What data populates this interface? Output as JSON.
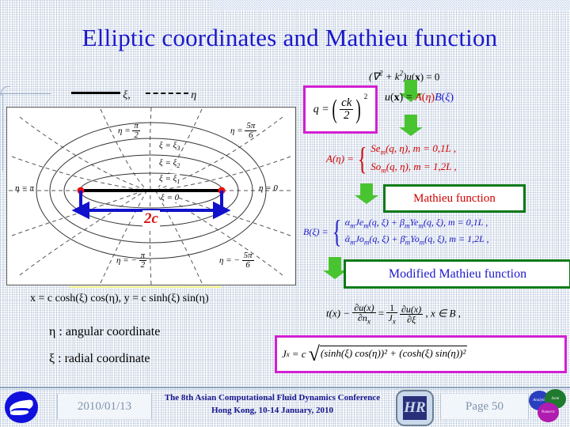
{
  "slide": {
    "title": "Elliptic coordinates and Mathieu function"
  },
  "legend": {
    "xi_label": "ξ,",
    "eta_label": "η"
  },
  "diagram": {
    "name": "elliptic-coordinate-system",
    "segment_label": "2c",
    "labels": {
      "eta_pi_half": "η =",
      "eta_5pi_6": "η =",
      "eta_pi": "η = π",
      "eta_0": "η = 0",
      "eta_neg_pi_half": "η = −",
      "eta_neg_5pi_6": "η = −",
      "xi_3": "ξ = ξ",
      "xi_3_sub": "3",
      "xi_2": "ξ = ξ",
      "xi_2_sub": "2",
      "xi_1": "ξ = ξ",
      "xi_1_sub": "1",
      "xi_0": "ξ = 0",
      "pi_num": "π",
      "two_den": "2",
      "five_pi_num": "5π",
      "six_den": "6"
    }
  },
  "equations": {
    "helmholtz": "(∇² + k²)u(x) = 0",
    "q_definition_lhs": "q =",
    "q_numerator": "ck",
    "q_denominator": "2",
    "q_power": "2",
    "separation": "u(x) = A(η)B(ξ)",
    "A_lhs": "A(η) =",
    "A_case1": "Se",
    "A_case1_sub": "m",
    "A_case1_rest": "(q, η), m = 0,1L  ,",
    "A_case2": "So",
    "A_case2_sub": "m",
    "A_case2_rest": "(q, η), m = 1,2L  ,",
    "B_lhs": "B(ξ) =",
    "B_case1": "α",
    "B_case1_sub": "m",
    "B_case1_mid": "Je",
    "B_case1_mid_sub": "m",
    "B_case1_rest": "(q, ξ) + β",
    "B_case1_sub2": "m",
    "B_case1_mid2": "Ye",
    "B_case1_mid2_sub": "m",
    "B_case1_end": "(q, ξ), m = 0,1L  ,",
    "B_case2": "ᾱ",
    "B_case2_sub": "m",
    "B_case2_mid": "Jo",
    "B_case2_mid_sub": "m",
    "B_case2_rest": "(q, ξ) + β̄",
    "B_case2_sub2": "m",
    "B_case2_mid2": "Yo",
    "B_case2_mid2_sub": "m",
    "B_case2_end": "(q, ξ), m = 1,2L  ,",
    "coordinate_transform": "x = c cosh(ξ) cos(η),  y = c sinh(ξ) sin(η)",
    "eta_meaning": "η :  angular coordinate",
    "xi_meaning": "ξ :  radial coordinate",
    "traction_lhs": "t(x) −",
    "traction_num1": "∂u(x)",
    "traction_den1": "∂n",
    "traction_den1_sub": "x",
    "traction_eq": "=",
    "traction_one": "1",
    "traction_J": "J",
    "traction_J_sub": "x",
    "traction_num2": "∂u(x)",
    "traction_den2": "∂ξ",
    "traction_tail": ", x ∈ B ,",
    "jacobian_lhs": "J",
    "jacobian_lhs_sub": "x",
    "jacobian_eq": "= c",
    "jacobian_radicand": "(sinh(ξ) cos(η))² + (cosh(ξ) sin(η))²"
  },
  "callouts": {
    "mathieu": "Mathieu function",
    "modified_mathieu": "Modified Mathieu function"
  },
  "footer": {
    "date": "2010/01/13",
    "conference_line1": "The 8th Asian Computational Fluid Dynamics Conference",
    "conference_line2": "Hong Kong, 10-14 January, 2010",
    "page": "Page 50",
    "hr_logo_text": "HR",
    "circle1_text": "Analytic",
    "circle2_text": "Semi",
    "circle3_text": "Numeric"
  },
  "colors": {
    "title_blue": "#1b18c9",
    "accent_red": "#d00000",
    "accent_magenta": "#d21fd2",
    "accent_green": "#0a7a18",
    "arrow_green": "#49c431"
  }
}
